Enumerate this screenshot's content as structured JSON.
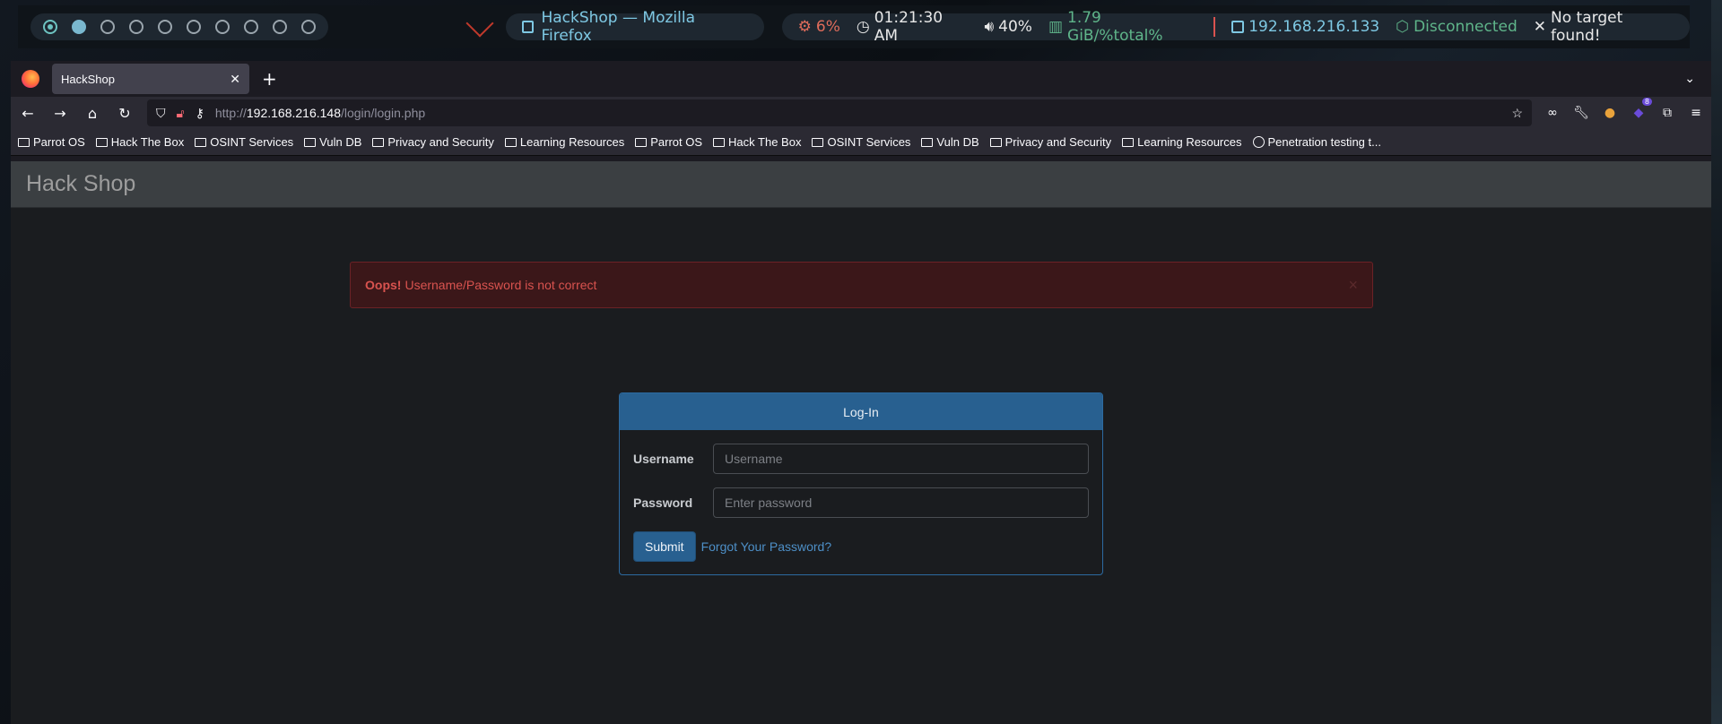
{
  "polybar": {
    "workspaces": 10,
    "window_title": "HackShop — Mozilla Firefox",
    "cpu": "6%",
    "time": "01:21:30 AM",
    "volume": "40%",
    "memory": "1.79 GiB/%total%",
    "ip": "192.168.216.133",
    "vpn": "Disconnected",
    "target": "No target found!"
  },
  "browser": {
    "tab_title": "HackShop",
    "url_scheme": "http://",
    "url_host": "192.168.216.148",
    "url_path": "/login/login.php",
    "bookmarks": [
      {
        "label": "Parrot OS",
        "icon": "folder-icon"
      },
      {
        "label": "Hack The Box",
        "icon": "folder-icon"
      },
      {
        "label": "OSINT Services",
        "icon": "folder-icon"
      },
      {
        "label": "Vuln DB",
        "icon": "folder-icon"
      },
      {
        "label": "Privacy and Security",
        "icon": "folder-icon"
      },
      {
        "label": "Learning Resources",
        "icon": "folder-icon"
      },
      {
        "label": "Parrot OS",
        "icon": "folder-icon"
      },
      {
        "label": "Hack The Box",
        "icon": "folder-icon"
      },
      {
        "label": "OSINT Services",
        "icon": "folder-icon"
      },
      {
        "label": "Vuln DB",
        "icon": "folder-icon"
      },
      {
        "label": "Privacy and Security",
        "icon": "folder-icon"
      },
      {
        "label": "Learning Resources",
        "icon": "folder-icon"
      },
      {
        "label": "Penetration testing t...",
        "icon": "globe-icon"
      }
    ]
  },
  "page": {
    "brand": "Hack Shop",
    "alert": {
      "strong": "Oops!",
      "message": "Username/Password is not correct",
      "close": "×"
    },
    "login": {
      "heading": "Log-In",
      "username_label": "Username",
      "username_placeholder": "Username",
      "password_label": "Password",
      "password_placeholder": "Enter password",
      "submit": "Submit",
      "forgot": "Forgot Your Password?"
    }
  },
  "colors": {
    "panel_primary": "#286090",
    "alert_text": "#d9534f",
    "navbar_bg": "#3b3f42"
  }
}
